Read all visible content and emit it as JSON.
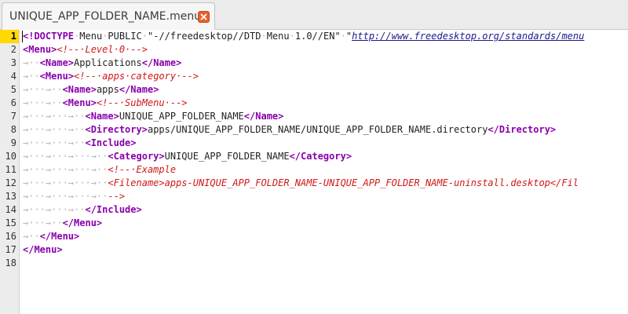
{
  "tab": {
    "title": "UNIQUE_APP_FOLDER_NAME.menu",
    "close_icon": "close-icon",
    "close_color": "#e8602c"
  },
  "editor": {
    "current_line": "1",
    "lines": [
      {
        "num": "1",
        "guides": "",
        "segments": [
          {
            "c": "doctype",
            "t": "<!DOCTYPE"
          },
          {
            "c": "ws",
            "t": "·"
          },
          {
            "c": "text",
            "t": "Menu"
          },
          {
            "c": "ws",
            "t": "·"
          },
          {
            "c": "text",
            "t": "PUBLIC"
          },
          {
            "c": "ws",
            "t": "·"
          },
          {
            "c": "str",
            "t": "\"-//freedesktop//DTD"
          },
          {
            "c": "ws",
            "t": "·"
          },
          {
            "c": "str",
            "t": "Menu"
          },
          {
            "c": "ws",
            "t": "·"
          },
          {
            "c": "str",
            "t": "1.0//EN\""
          },
          {
            "c": "ws",
            "t": "·"
          },
          {
            "c": "str",
            "t": "\""
          },
          {
            "c": "url",
            "t": "http://www.freedesktop.org/standards/menu"
          }
        ]
      },
      {
        "num": "2",
        "guides": "",
        "segments": [
          {
            "c": "tag",
            "t": "<Menu>"
          },
          {
            "c": "comment",
            "t": "<!--·Level·0·-->"
          }
        ]
      },
      {
        "num": "3",
        "guides": "→··",
        "segments": [
          {
            "c": "tag",
            "t": "<Name>"
          },
          {
            "c": "text",
            "t": "Applications"
          },
          {
            "c": "tag",
            "t": "</Name>"
          }
        ]
      },
      {
        "num": "4",
        "guides": "→··",
        "segments": [
          {
            "c": "tag",
            "t": "<Menu>"
          },
          {
            "c": "comment",
            "t": "<!--·apps·category·-->"
          }
        ]
      },
      {
        "num": "5",
        "guides": "→···→··",
        "segments": [
          {
            "c": "tag",
            "t": "<Name>"
          },
          {
            "c": "text",
            "t": "apps"
          },
          {
            "c": "tag",
            "t": "</Name>"
          }
        ]
      },
      {
        "num": "6",
        "guides": "→···→··",
        "segments": [
          {
            "c": "tag",
            "t": "<Menu>"
          },
          {
            "c": "comment",
            "t": "<!--·SubMenu·-->"
          }
        ]
      },
      {
        "num": "7",
        "guides": "→···→···→··",
        "segments": [
          {
            "c": "tag",
            "t": "<Name>"
          },
          {
            "c": "text",
            "t": "UNIQUE_APP_FOLDER_NAME"
          },
          {
            "c": "tag",
            "t": "</Name>"
          }
        ]
      },
      {
        "num": "8",
        "guides": "→···→···→··",
        "segments": [
          {
            "c": "tag",
            "t": "<Directory>"
          },
          {
            "c": "text",
            "t": "apps/UNIQUE_APP_FOLDER_NAME/UNIQUE_APP_FOLDER_NAME.directory"
          },
          {
            "c": "tag",
            "t": "</Directory>"
          }
        ]
      },
      {
        "num": "9",
        "guides": "→···→···→··",
        "segments": [
          {
            "c": "tag",
            "t": "<Include>"
          }
        ]
      },
      {
        "num": "10",
        "guides": "→···→···→···→··",
        "segments": [
          {
            "c": "tag",
            "t": "<Category>"
          },
          {
            "c": "text",
            "t": "UNIQUE_APP_FOLDER_NAME"
          },
          {
            "c": "tag",
            "t": "</Category>"
          }
        ]
      },
      {
        "num": "11",
        "guides": "→···→···→···→··",
        "segments": [
          {
            "c": "comment",
            "t": "<!--·Example"
          }
        ]
      },
      {
        "num": "12",
        "guides": "→···→···→···→··",
        "segments": [
          {
            "c": "comment",
            "t": "<Filename>apps-UNIQUE_APP_FOLDER_NAME-UNIQUE_APP_FOLDER_NAME-uninstall.desktop</Fil"
          }
        ]
      },
      {
        "num": "13",
        "guides": "→···→···→···→··",
        "segments": [
          {
            "c": "comment",
            "t": "-->"
          }
        ]
      },
      {
        "num": "14",
        "guides": "→···→···→··",
        "segments": [
          {
            "c": "tag",
            "t": "</Include>"
          }
        ]
      },
      {
        "num": "15",
        "guides": "→···→··",
        "segments": [
          {
            "c": "tag",
            "t": "</Menu>"
          }
        ]
      },
      {
        "num": "16",
        "guides": "→··",
        "segments": [
          {
            "c": "tag",
            "t": "</Menu>"
          }
        ]
      },
      {
        "num": "17",
        "guides": "",
        "segments": [
          {
            "c": "tag",
            "t": "</Menu>"
          }
        ]
      },
      {
        "num": "18",
        "guides": "",
        "segments": []
      }
    ]
  }
}
